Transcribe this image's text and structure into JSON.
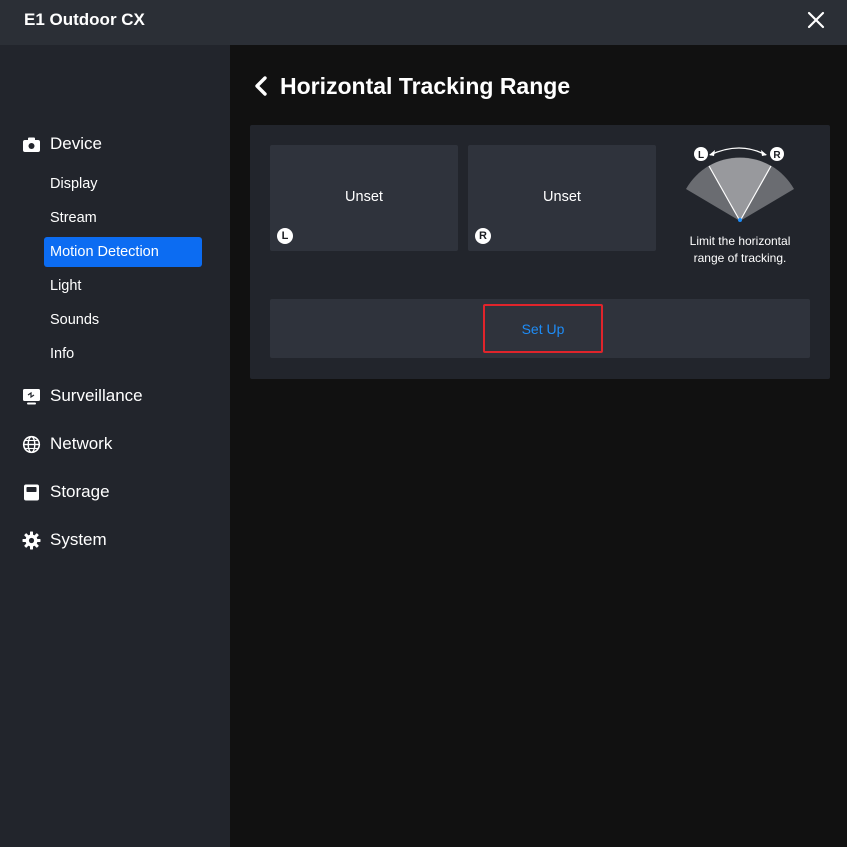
{
  "window": {
    "title": "E1 Outdoor CX",
    "close_icon": "close-icon"
  },
  "sidebar": {
    "sections": [
      {
        "label": "Device",
        "icon": "camera-icon"
      },
      {
        "label": "Surveillance",
        "icon": "monitor-icon"
      },
      {
        "label": "Network",
        "icon": "globe-icon"
      },
      {
        "label": "Storage",
        "icon": "storage-icon"
      },
      {
        "label": "System",
        "icon": "gear-icon"
      }
    ],
    "device_items": [
      {
        "label": "Display",
        "active": false
      },
      {
        "label": "Stream",
        "active": false
      },
      {
        "label": "Motion Detection",
        "active": true
      },
      {
        "label": "Light",
        "active": false
      },
      {
        "label": "Sounds",
        "active": false
      },
      {
        "label": "Info",
        "active": false
      }
    ]
  },
  "page": {
    "title": "Horizontal Tracking Range",
    "left_position": {
      "value": "Unset",
      "badge": "L"
    },
    "right_position": {
      "value": "Unset",
      "badge": "R"
    },
    "diagram": {
      "left_badge": "L",
      "right_badge": "R"
    },
    "hint": "Limit the horizontal range of tracking.",
    "setup_label": "Set Up"
  },
  "colors": {
    "accent": "#0c6cf2",
    "link": "#1e8cf6",
    "highlight_border": "#e0242b",
    "sidebar_bg": "#22252c",
    "titlebar_bg": "#2b2f36",
    "main_bg": "#111111"
  }
}
